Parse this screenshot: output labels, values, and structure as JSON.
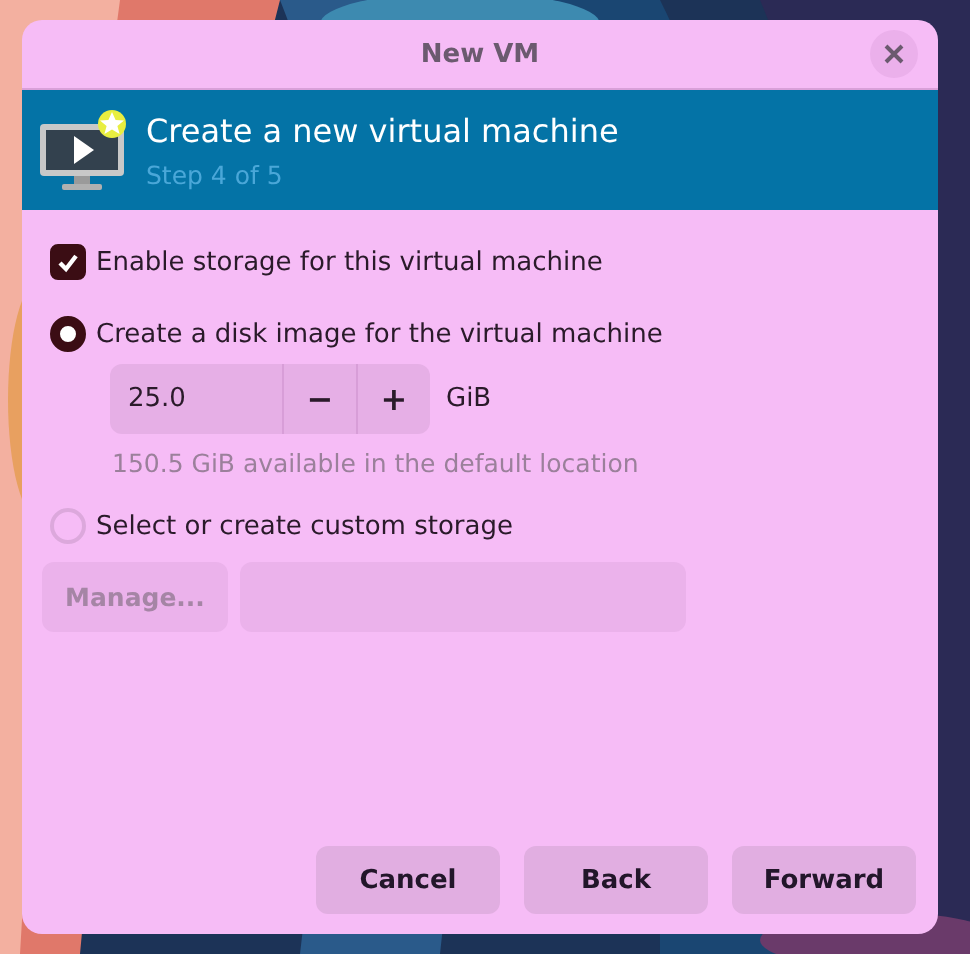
{
  "window": {
    "title": "New VM"
  },
  "banner": {
    "title": "Create a new virtual machine",
    "subtitle": "Step 4 of 5"
  },
  "enable_storage": {
    "label": "Enable storage for this virtual machine",
    "checked": true
  },
  "options": [
    {
      "label": "Create a disk image for the virtual machine",
      "selected": true
    },
    {
      "label": "Select or create custom storage",
      "selected": false
    }
  ],
  "size": {
    "value": "25.0",
    "decrement": "−",
    "increment": "+",
    "unit": "GiB"
  },
  "hint": "150.5 GiB available in the default location",
  "manage": {
    "label": "Manage...",
    "disabled": true
  },
  "buttons": [
    {
      "label": "Cancel"
    },
    {
      "label": "Back"
    },
    {
      "label": "Forward"
    }
  ]
}
